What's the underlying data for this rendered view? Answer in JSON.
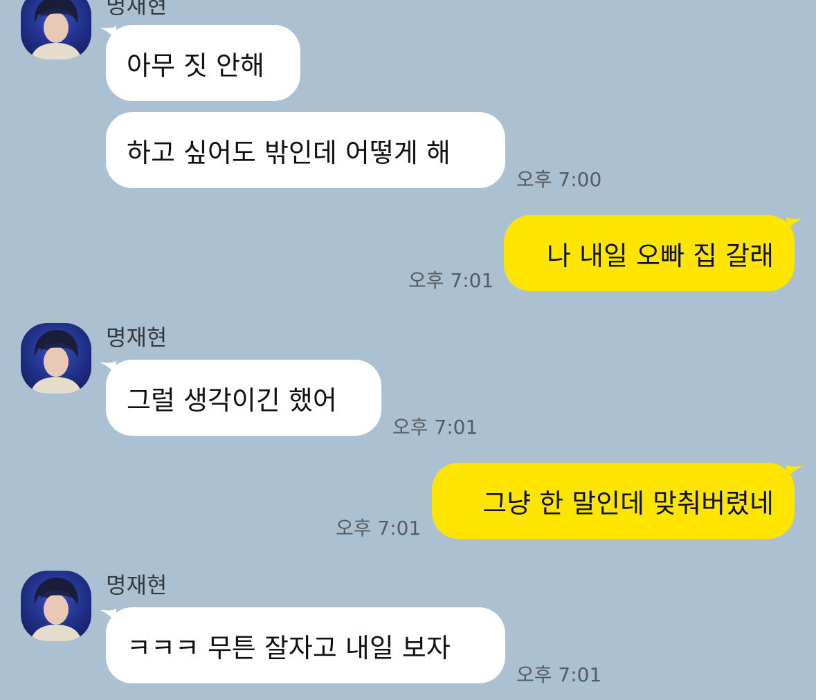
{
  "colors": {
    "background": "#abc1d1",
    "incoming_bubble": "#ffffff",
    "outgoing_bubble": "#fee500"
  },
  "messages": [
    {
      "direction": "incoming",
      "sender": "명재현",
      "text": "아무 짓 안해"
    },
    {
      "direction": "incoming",
      "text": "하고 싶어도 밖인데 어떻게 해",
      "time": "오후 7:00"
    },
    {
      "direction": "outgoing",
      "text": "나 내일 오빠 집 갈래",
      "time": "오후 7:01"
    },
    {
      "direction": "incoming",
      "sender": "명재현",
      "text": "그럴 생각이긴 했어",
      "time": "오후 7:01"
    },
    {
      "direction": "outgoing",
      "text": "그냥 한 말인데 맞춰버렸네",
      "time": "오후 7:01"
    },
    {
      "direction": "incoming",
      "sender": "명재현",
      "text": "ㅋㅋㅋ 무튼 잘자고 내일 보자",
      "time": "오후 7:01"
    }
  ],
  "avatar_icon": "profile-photo"
}
